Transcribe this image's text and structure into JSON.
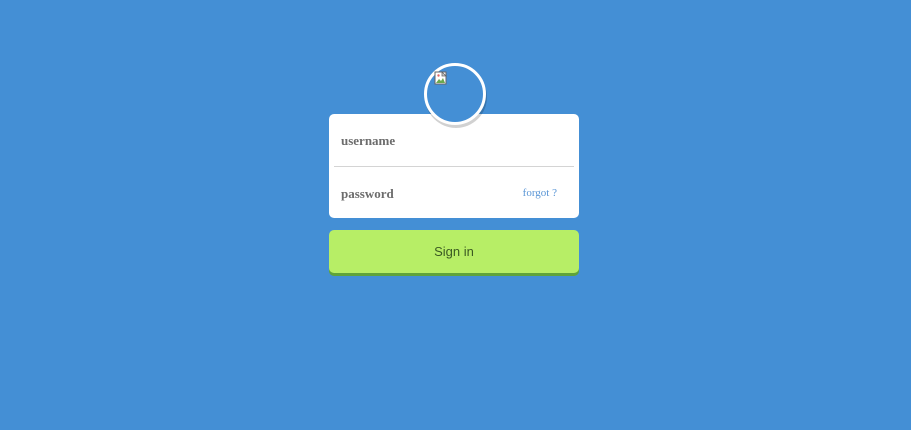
{
  "colors": {
    "background": "#448fd5",
    "card": "#ffffff",
    "button": "#b7ee66",
    "button_shadow": "#5fa33a",
    "link": "#5a96d6"
  },
  "avatar": {
    "icon": "broken-image-icon"
  },
  "form": {
    "username_label": "username",
    "password_label": "password",
    "forgot_label": "forgot ?"
  },
  "signin": {
    "label": "Sign in"
  }
}
